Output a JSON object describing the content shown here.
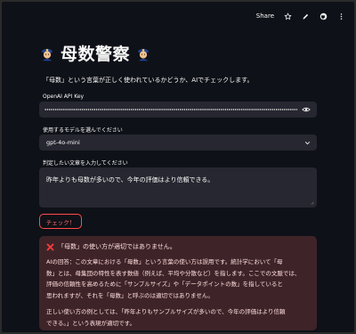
{
  "topbar": {
    "share_label": "Share"
  },
  "header": {
    "title": "母数警察"
  },
  "description": "「母数」という言葉が正しく使われているかどうか、AIでチェックします。",
  "api_key": {
    "label": "OpenAI API Key",
    "value": "•••••••••••••••••••••••••••••••••••••••••••••••••••"
  },
  "model": {
    "label": "使用するモデルを選んでください",
    "selected": "gpt-4o-mini"
  },
  "input_text": {
    "label": "判定したい文章を入力してください",
    "value": "昨年よりも母数が多いので、今年の評価はより信頼できる。"
  },
  "check_button": {
    "label": "チェック！"
  },
  "result": {
    "heading": "「母数」の使い方が適切ではありません。",
    "answer_lines": [
      "AIの回答：この文章における「母数」という言葉の使い方は誤用です。統計学において「母",
      "数」とは、母集団の特性を表す数値（例えば、平均や分散など）を指します。ここでの文脈では、",
      "評価の信頼性を高めるために「サンプルサイズ」や「データポイントの数」を指していると",
      "思われますが、それを「母数」と呼ぶのは適切ではありません。"
    ],
    "example_lines": [
      "正しい使い方の例としては、「昨年よりもサンプルサイズが多いので、今年の評価はより信頼",
      "できる。」という表現が適切です。"
    ]
  },
  "colors": {
    "background": "#0e1117",
    "input_bg": "#262730",
    "accent": "#ff4b4b",
    "error_bg": "#3e2428"
  }
}
